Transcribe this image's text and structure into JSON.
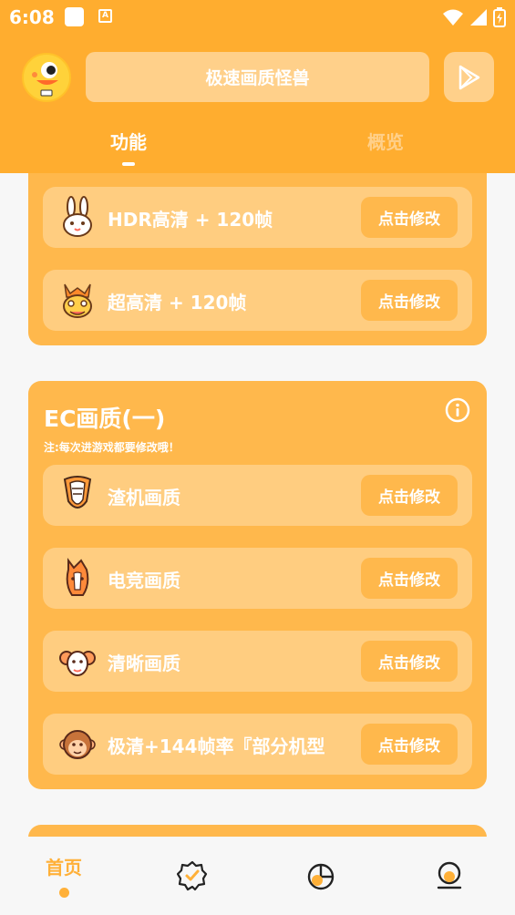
{
  "status_bar": {
    "time": "6:08"
  },
  "header": {
    "title": "极速画质怪兽",
    "tabs": [
      {
        "label": "功能",
        "active": true
      },
      {
        "label": "概览",
        "active": false
      }
    ]
  },
  "card_top": {
    "items": [
      {
        "icon": "rabbit-icon",
        "label": "HDR高清 + 120帧",
        "button": "点击修改"
      },
      {
        "icon": "dragon-icon",
        "label": "超高清 + 120帧",
        "button": "点击修改"
      }
    ]
  },
  "card_ec": {
    "title": "EC画质(一)",
    "note": "注:每次进游戏都要修改哦！",
    "items": [
      {
        "icon": "snake-icon",
        "label": "渣机画质",
        "button": "点击修改"
      },
      {
        "icon": "horse-icon",
        "label": "电竞画质",
        "button": "点击修改"
      },
      {
        "icon": "ram-icon",
        "label": "清晰画质",
        "button": "点击修改"
      },
      {
        "icon": "monkey-icon",
        "label": "极清+144帧率『部分机型",
        "button": "点击修改"
      }
    ]
  },
  "bottom_nav": {
    "items": [
      {
        "label": "首页",
        "icon": "home",
        "active": true
      },
      {
        "label": "",
        "icon": "verified-badge-icon"
      },
      {
        "label": "",
        "icon": "pie-chart-icon"
      },
      {
        "label": "",
        "icon": "profile-icon"
      }
    ]
  },
  "colors": {
    "primary": "#ffad2f",
    "card": "#ffb84c",
    "row": "#ffcd80",
    "background": "#f7f7f7"
  }
}
